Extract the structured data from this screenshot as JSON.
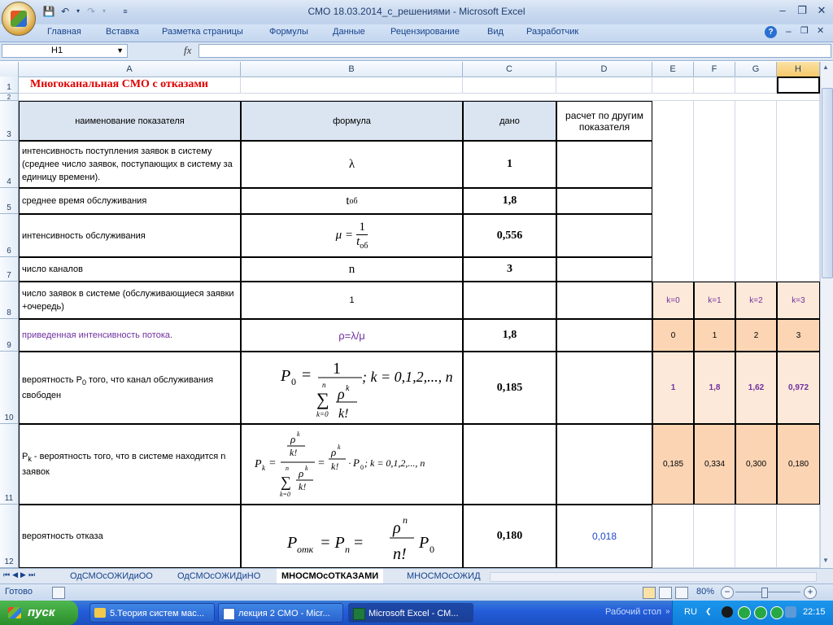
{
  "window": {
    "title": "СМО 18.03.2014_с_решениями - Microsoft Excel"
  },
  "ribbon_tabs": [
    "Главная",
    "Вставка",
    "Разметка страницы",
    "Формулы",
    "Данные",
    "Рецензирование",
    "Вид",
    "Разработчик"
  ],
  "formula_bar": {
    "name_box": "H1",
    "fx_label": "fx",
    "formula": ""
  },
  "columns": [
    "A",
    "B",
    "C",
    "D",
    "E",
    "F",
    "G",
    "H"
  ],
  "rows": [
    "1",
    "2",
    "3",
    "4",
    "5",
    "6",
    "7",
    "8",
    "9",
    "10",
    "11",
    "12"
  ],
  "sheet": {
    "title": "Многоканальная СМО с отказами",
    "headers": {
      "name": "наименование показателя",
      "formula": "формула",
      "given": "дано",
      "calc": "расчет по другим показателя"
    },
    "r4": {
      "name": "интенсивность поступления заявок в систему (среднее число заявок, поступающих в систему за единицу времени).",
      "formula": "λ",
      "given": "1"
    },
    "r5": {
      "name": "среднее время обслуживания",
      "formula_main": "t",
      "formula_sub": "об",
      "given": "1,8"
    },
    "r6": {
      "name": "интенсивность обслуживания",
      "formula_lhs": "μ =",
      "formula_num": "1",
      "formula_den": "t",
      "formula_den_sub": "об",
      "given": "0,556"
    },
    "r7": {
      "name": "число каналов",
      "formula": "n",
      "given": "3"
    },
    "r8": {
      "name": "число заявок в системе (обслуживающиеся заявки +очередь)",
      "formula": "1",
      "k": [
        "k=0",
        "k=1",
        "k=2",
        "k=3"
      ]
    },
    "r9": {
      "name": "приведенная интенсивность потока.",
      "formula": "ρ=λ/μ",
      "given": "1,8",
      "k": [
        "0",
        "1",
        "2",
        "3"
      ]
    },
    "r10": {
      "name_pre": "вероятность P",
      "name_sub": "0",
      "name_post": " того, что канал обслуживания свободен",
      "formula_lhs": "P",
      "formula_lhs_sub": "0",
      "formula_eq": "=",
      "formula_num": "1",
      "formula_rhs": "; k = 0,1,2,..., n",
      "given": "0,185",
      "k": [
        "1",
        "1,8",
        "1,62",
        "0,972"
      ]
    },
    "r11": {
      "name_pre": "P",
      "name_sub": "k",
      "name_post": "  - вероятность того, что в системе находится n заявок",
      "formula_rhs": "; k = 0,1,2,..., n",
      "k": [
        "0,185",
        "0,334",
        "0,300",
        "0,180"
      ]
    },
    "r12": {
      "name": "вероятность отказа",
      "formula": "P",
      "formula_sub1": "отк",
      "formula_mid": " = P",
      "formula_sub2": "n",
      "formula_eq": " =",
      "formula_num": "ρ",
      "formula_num_sup": "n",
      "formula_den": "n!",
      "formula_tail": "P",
      "formula_tail_sub": "0",
      "given": "0,180",
      "calc": "0,018"
    }
  },
  "sheet_tabs": [
    "ОдСМОсОЖИдиОО",
    "ОдСМОсОЖИДиНО",
    "МНОСМОсОТКАЗАМИ",
    "МНОСМОсОЖИД"
  ],
  "active_sheet": "МНОСМОсОТКАЗАМИ",
  "status": {
    "ready": "Готово",
    "zoom": "80%"
  },
  "taskbar": {
    "start": "пуск",
    "tasks": [
      "5.Теория систем мас...",
      "лекция 2 СМО - Micr...",
      "Microsoft Excel - СМ..."
    ],
    "desktop": "Рабочий стол",
    "lang": "RU",
    "time": "22:15"
  }
}
